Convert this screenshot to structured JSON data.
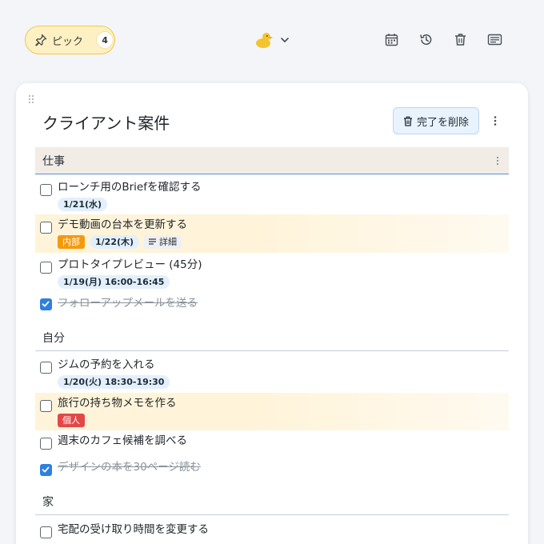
{
  "header": {
    "pick_label": "ピック",
    "pick_count": "4",
    "logo_icon": "duck-icon",
    "icons": [
      "calendar-icon",
      "history-icon",
      "trash-icon",
      "card-icon"
    ]
  },
  "card": {
    "title": "クライアント案件",
    "delete_done_label": "完了を削除"
  },
  "sections": [
    {
      "name": "仕事",
      "tasks": [
        {
          "text": "ローンチ用のBriefを確認する",
          "date": "1/21(水)",
          "done": false
        },
        {
          "text": "デモ動画の台本を更新する",
          "tag": "内部",
          "date": "1/22(木)",
          "detail": "詳細",
          "done": false
        },
        {
          "text": "プロトタイプレビュー (45分)",
          "date": "1/19(月) 16:00-16:45",
          "done": false
        },
        {
          "text": "フォローアップメールを送る",
          "done": true
        }
      ]
    },
    {
      "name": "自分",
      "tasks": [
        {
          "text": "ジムの予約を入れる",
          "date": "1/20(火) 18:30-19:30",
          "done": false
        },
        {
          "text": "旅行の持ち物メモを作る",
          "tag": "個人",
          "done": false
        },
        {
          "text": "週末のカフェ候補を調べる",
          "done": false
        },
        {
          "text": "デザインの本を30ページ読む",
          "done": true
        }
      ]
    },
    {
      "name": "家",
      "tasks": [
        {
          "text": "宅配の受け取り時間を変更する",
          "done": false
        }
      ]
    }
  ],
  "colors": {
    "pick_bg": "#fdf1c4",
    "accent_blue": "#2f7fe0",
    "tag_orange": "#f29a0f",
    "tag_red": "#e34848",
    "highlight": "#fff4d9"
  }
}
